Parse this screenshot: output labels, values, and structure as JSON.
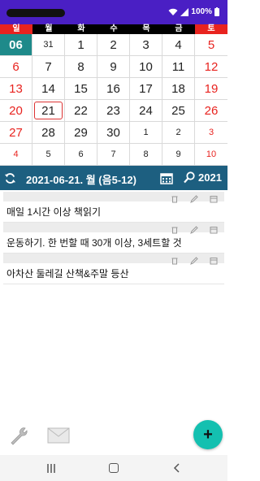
{
  "status": {
    "battery": "100%"
  },
  "weekdays": [
    "일",
    "월",
    "화",
    "수",
    "목",
    "금",
    "토"
  ],
  "calendar": {
    "month_label": "06",
    "today": "21",
    "rows": [
      [
        "06",
        "31",
        "1",
        "2",
        "3",
        "4",
        "5"
      ],
      [
        "6",
        "7",
        "8",
        "9",
        "10",
        "11",
        "12"
      ],
      [
        "13",
        "14",
        "15",
        "16",
        "17",
        "18",
        "19"
      ],
      [
        "20",
        "21",
        "22",
        "23",
        "24",
        "25",
        "26"
      ],
      [
        "27",
        "28",
        "29",
        "30",
        "1",
        "2",
        "3"
      ],
      [
        "4",
        "5",
        "6",
        "7",
        "8",
        "9",
        "10"
      ]
    ]
  },
  "date_bar": {
    "title": "2021-06-21. 월 (음5-12)",
    "year": "2021"
  },
  "notes": [
    {
      "text": "매일 1시간 이상 책읽기"
    },
    {
      "text": "운동하기. 한 번할 때 30개 이상, 3세트할 것"
    },
    {
      "text": "아차산 둘레길 산책&주말 등산"
    }
  ],
  "fab": {
    "label": "+"
  },
  "colors": {
    "status_bar": "#4a1fc4",
    "accent_red": "#e8231f",
    "date_bar": "#1d5f80",
    "fab": "#14c0b0",
    "month_cell": "#1e8a8a"
  }
}
